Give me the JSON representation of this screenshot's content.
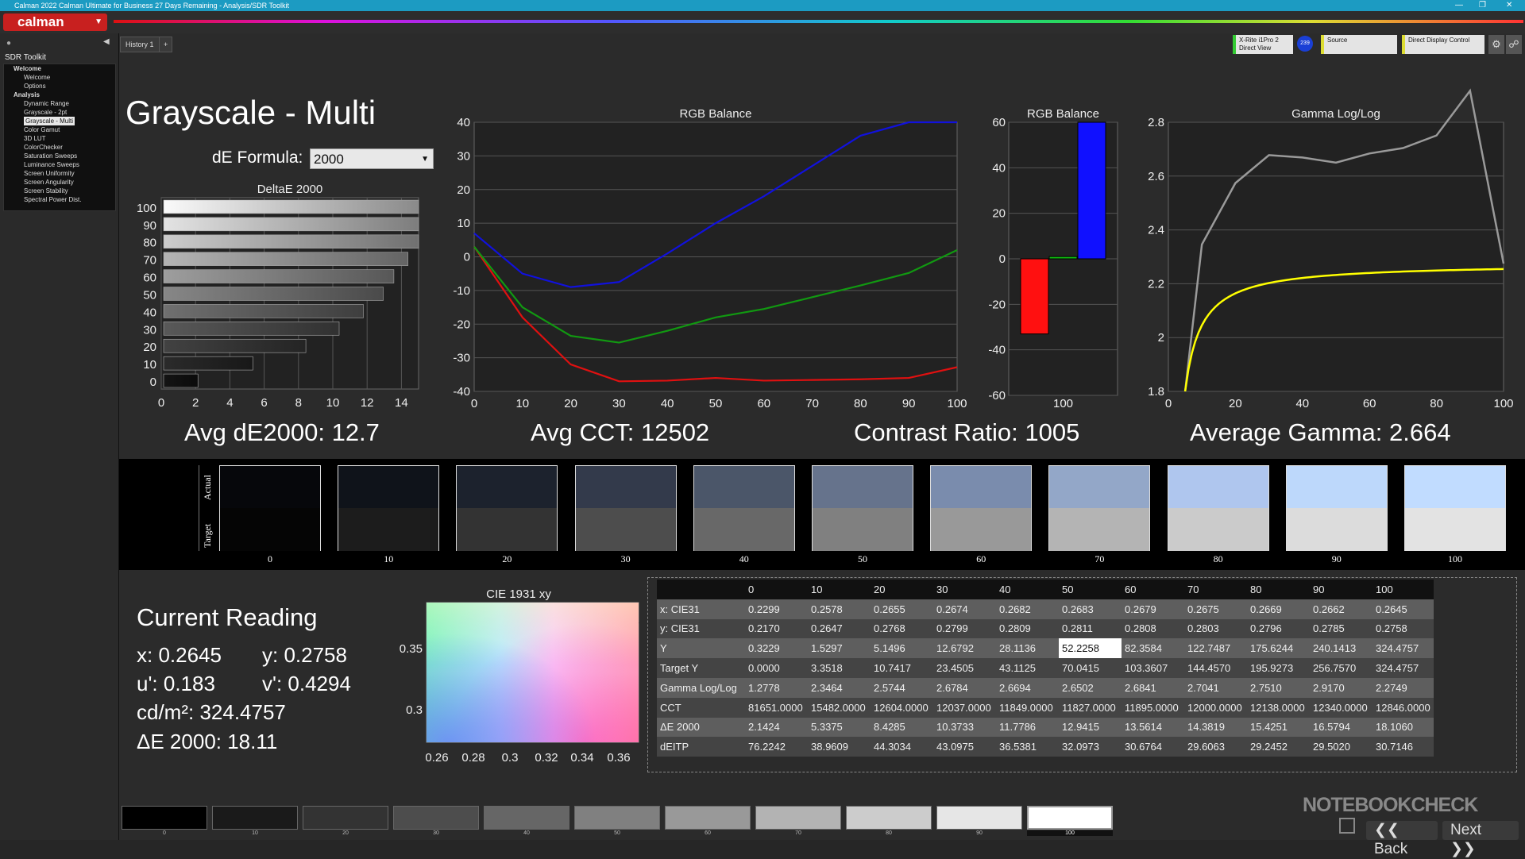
{
  "titlebar": {
    "text": "Calman 2022 Calman Ultimate for Business 27 Days Remaining  - Analysis/SDR Toolkit"
  },
  "app": {
    "logo": "calman"
  },
  "tabs": {
    "history": "History 1",
    "add": "+"
  },
  "hardware": {
    "meter": "X-Rite i1Pro 2",
    "meter_sub": "Direct View",
    "meter_badge": "239",
    "source": "Source",
    "display": "Direct Display Control"
  },
  "sidebar": {
    "header": "SDR Toolkit",
    "items": [
      {
        "label": "Welcome",
        "level": 0
      },
      {
        "label": "Welcome",
        "level": 1
      },
      {
        "label": "Options",
        "level": 1
      },
      {
        "label": "Analysis",
        "level": 0
      },
      {
        "label": "Dynamic Range",
        "level": 1
      },
      {
        "label": "Grayscale - 2pt",
        "level": 1
      },
      {
        "label": "Grayscale - Multi",
        "level": 1,
        "selected": true
      },
      {
        "label": "Color Gamut",
        "level": 1
      },
      {
        "label": "3D LUT",
        "level": 1
      },
      {
        "label": "ColorChecker",
        "level": 1
      },
      {
        "label": "Saturation Sweeps",
        "level": 1
      },
      {
        "label": "Luminance Sweeps",
        "level": 1
      },
      {
        "label": "Screen Uniformity",
        "level": 1
      },
      {
        "label": "Screen Angularity",
        "level": 1
      },
      {
        "label": "Screen Stability",
        "level": 1
      },
      {
        "label": "Spectral Power Dist.",
        "level": 1
      }
    ]
  },
  "page": {
    "title": "Grayscale - Multi",
    "de_formula_label": "dE Formula:",
    "de_formula_value": "2000"
  },
  "stats": {
    "avg_de": "Avg dE2000: 12.7",
    "avg_cct": "Avg CCT: 12502",
    "contrast": "Contrast Ratio: 1005",
    "avg_gamma": "Average Gamma: 2.664"
  },
  "chart_data": [
    {
      "type": "bar",
      "title": "DeltaE 2000",
      "orientation": "horizontal",
      "categories": [
        "0",
        "10",
        "20",
        "30",
        "40",
        "50",
        "60",
        "70",
        "80",
        "90",
        "100"
      ],
      "values": [
        2.14,
        5.34,
        8.43,
        10.37,
        11.78,
        12.94,
        13.56,
        14.38,
        15.43,
        16.58,
        18.11
      ],
      "xlim": [
        0,
        15
      ],
      "xticks": [
        "0",
        "2",
        "4",
        "6",
        "8",
        "10",
        "12",
        "14"
      ]
    },
    {
      "type": "line",
      "title": "RGB Balance",
      "x": [
        0,
        10,
        20,
        30,
        40,
        50,
        60,
        70,
        80,
        90,
        100
      ],
      "series": [
        {
          "name": "red",
          "color": "#e01010",
          "values": [
            3,
            -18,
            -32,
            -37,
            -36.8,
            -36,
            -36.8,
            -36.6,
            -36.4,
            -36,
            -32.8
          ]
        },
        {
          "name": "green",
          "color": "#119911",
          "values": [
            3,
            -15,
            -23.5,
            -25.5,
            -22,
            -18,
            -15.5,
            -12,
            -8.5,
            -4.8,
            2
          ]
        },
        {
          "name": "blue",
          "color": "#1111dd",
          "values": [
            7,
            -5,
            -9,
            -7.5,
            1,
            10,
            18,
            27,
            36,
            40,
            40
          ]
        }
      ],
      "xlim": [
        0,
        100
      ],
      "ylim": [
        -40,
        40
      ],
      "xticks": [
        "0",
        "10",
        "20",
        "30",
        "40",
        "50",
        "60",
        "70",
        "80",
        "90",
        "100"
      ],
      "yticks": [
        "40",
        "30",
        "20",
        "10",
        "0",
        "-10",
        "-20",
        "-30",
        "-40"
      ]
    },
    {
      "type": "bar",
      "title": "RGB Balance",
      "categories": [
        "100"
      ],
      "series": [
        {
          "name": "red",
          "color": "#ff1010",
          "values": [
            -33
          ]
        },
        {
          "name": "green",
          "color": "#10c010",
          "values": [
            1
          ]
        },
        {
          "name": "blue",
          "color": "#1010ff",
          "values": [
            60
          ]
        }
      ],
      "ylim": [
        -60,
        60
      ],
      "yticks": [
        "60",
        "40",
        "20",
        "0",
        "-20",
        "-40",
        "-60"
      ]
    },
    {
      "type": "line",
      "title": "Gamma Log/Log",
      "x": [
        0,
        10,
        20,
        30,
        40,
        50,
        60,
        70,
        80,
        90,
        100
      ],
      "series": [
        {
          "name": "measured",
          "color": "#9a9a9a",
          "values": [
            null,
            2.346,
            2.574,
            2.678,
            2.669,
            2.65,
            2.684,
            2.704,
            2.751,
            2.917,
            2.275
          ]
        },
        {
          "name": "target",
          "color": "#ffff00",
          "values": [
            null,
            2.0,
            2.12,
            2.17,
            2.2,
            2.22,
            2.235,
            2.245,
            2.255,
            2.265,
            2.275
          ]
        }
      ],
      "xlim": [
        0,
        100
      ],
      "ylim": [
        1.8,
        2.8
      ],
      "xticks": [
        "0",
        "20",
        "40",
        "60",
        "80",
        "100"
      ],
      "yticks": [
        "2.8",
        "2.6",
        "2.4",
        "2.2",
        "2",
        "1.8"
      ]
    }
  ],
  "swatches": {
    "actual_label": "Actual",
    "target_label": "Target",
    "items": [
      {
        "label": "0",
        "actual": "#06070b",
        "target": "#050505"
      },
      {
        "label": "10",
        "actual": "#0f131a",
        "target": "#1c1c1c"
      },
      {
        "label": "20",
        "actual": "#1c222d",
        "target": "#333333"
      },
      {
        "label": "30",
        "actual": "#333a4b",
        "target": "#4d4d4d"
      },
      {
        "label": "40",
        "actual": "#4b5669",
        "target": "#686868"
      },
      {
        "label": "50",
        "actual": "#66738c",
        "target": "#808080"
      },
      {
        "label": "60",
        "actual": "#7a8cad",
        "target": "#999999"
      },
      {
        "label": "70",
        "actual": "#93a7c8",
        "target": "#b4b4b4"
      },
      {
        "label": "80",
        "actual": "#afc6ee",
        "target": "#cbcbcb"
      },
      {
        "label": "90",
        "actual": "#bdd8fb",
        "target": "#dcdcdc"
      },
      {
        "label": "100",
        "actual": "#c1dcff",
        "target": "#e3e3e3"
      }
    ]
  },
  "reading": {
    "title": "Current Reading",
    "x": "x: 0.2645",
    "y": "y: 0.2758",
    "u": "u': 0.183",
    "v": "v': 0.4294",
    "cd": "cd/m²: 324.4757",
    "de": "ΔE 2000: 18.11"
  },
  "cie": {
    "title": "CIE 1931 xy",
    "xticks": [
      "0.26",
      "0.28",
      "0.3",
      "0.32",
      "0.34",
      "0.36"
    ],
    "yticks": [
      "0.35",
      "0.3"
    ]
  },
  "table": {
    "headers": [
      "",
      "0",
      "10",
      "20",
      "30",
      "40",
      "50",
      "60",
      "70",
      "80",
      "90",
      "100"
    ],
    "rows": [
      [
        "x: CIE31",
        "0.2299",
        "0.2578",
        "0.2655",
        "0.2674",
        "0.2682",
        "0.2683",
        "0.2679",
        "0.2675",
        "0.2669",
        "0.2662",
        "0.2645"
      ],
      [
        "y: CIE31",
        "0.2170",
        "0.2647",
        "0.2768",
        "0.2799",
        "0.2809",
        "0.2811",
        "0.2808",
        "0.2803",
        "0.2796",
        "0.2785",
        "0.2758"
      ],
      [
        "Y",
        "0.3229",
        "1.5297",
        "5.1496",
        "12.6792",
        "28.1136",
        "52.2258",
        "82.3584",
        "122.7487",
        "175.6244",
        "240.1413",
        "324.4757"
      ],
      [
        "Target Y",
        "0.0000",
        "3.3518",
        "10.7417",
        "23.4505",
        "43.1125",
        "70.0415",
        "103.3607",
        "144.4570",
        "195.9273",
        "256.7570",
        "324.4757"
      ],
      [
        "Gamma Log/Log",
        "1.2778",
        "2.3464",
        "2.5744",
        "2.6784",
        "2.6694",
        "2.6502",
        "2.6841",
        "2.7041",
        "2.7510",
        "2.9170",
        "2.2749"
      ],
      [
        "CCT",
        "81651.0000",
        "15482.0000",
        "12604.0000",
        "12037.0000",
        "11849.0000",
        "11827.0000",
        "11895.0000",
        "12000.0000",
        "12138.0000",
        "12340.0000",
        "12846.0000"
      ],
      [
        "ΔE 2000",
        "2.1424",
        "5.3375",
        "8.4285",
        "10.3733",
        "11.7786",
        "12.9415",
        "13.5614",
        "14.3819",
        "15.4251",
        "16.5794",
        "18.1060"
      ],
      [
        "dEITP",
        "76.2242",
        "38.9609",
        "44.3034",
        "43.0975",
        "36.5381",
        "32.0973",
        "30.6764",
        "29.6063",
        "29.2452",
        "29.5020",
        "30.7146"
      ]
    ]
  },
  "patches": {
    "labels": [
      "0",
      "10",
      "20",
      "30",
      "40",
      "50",
      "60",
      "70",
      "80",
      "90",
      "100"
    ]
  },
  "nav": {
    "back": "Back",
    "next": "Next"
  },
  "watermark": "NOTEBOOKCHECK"
}
